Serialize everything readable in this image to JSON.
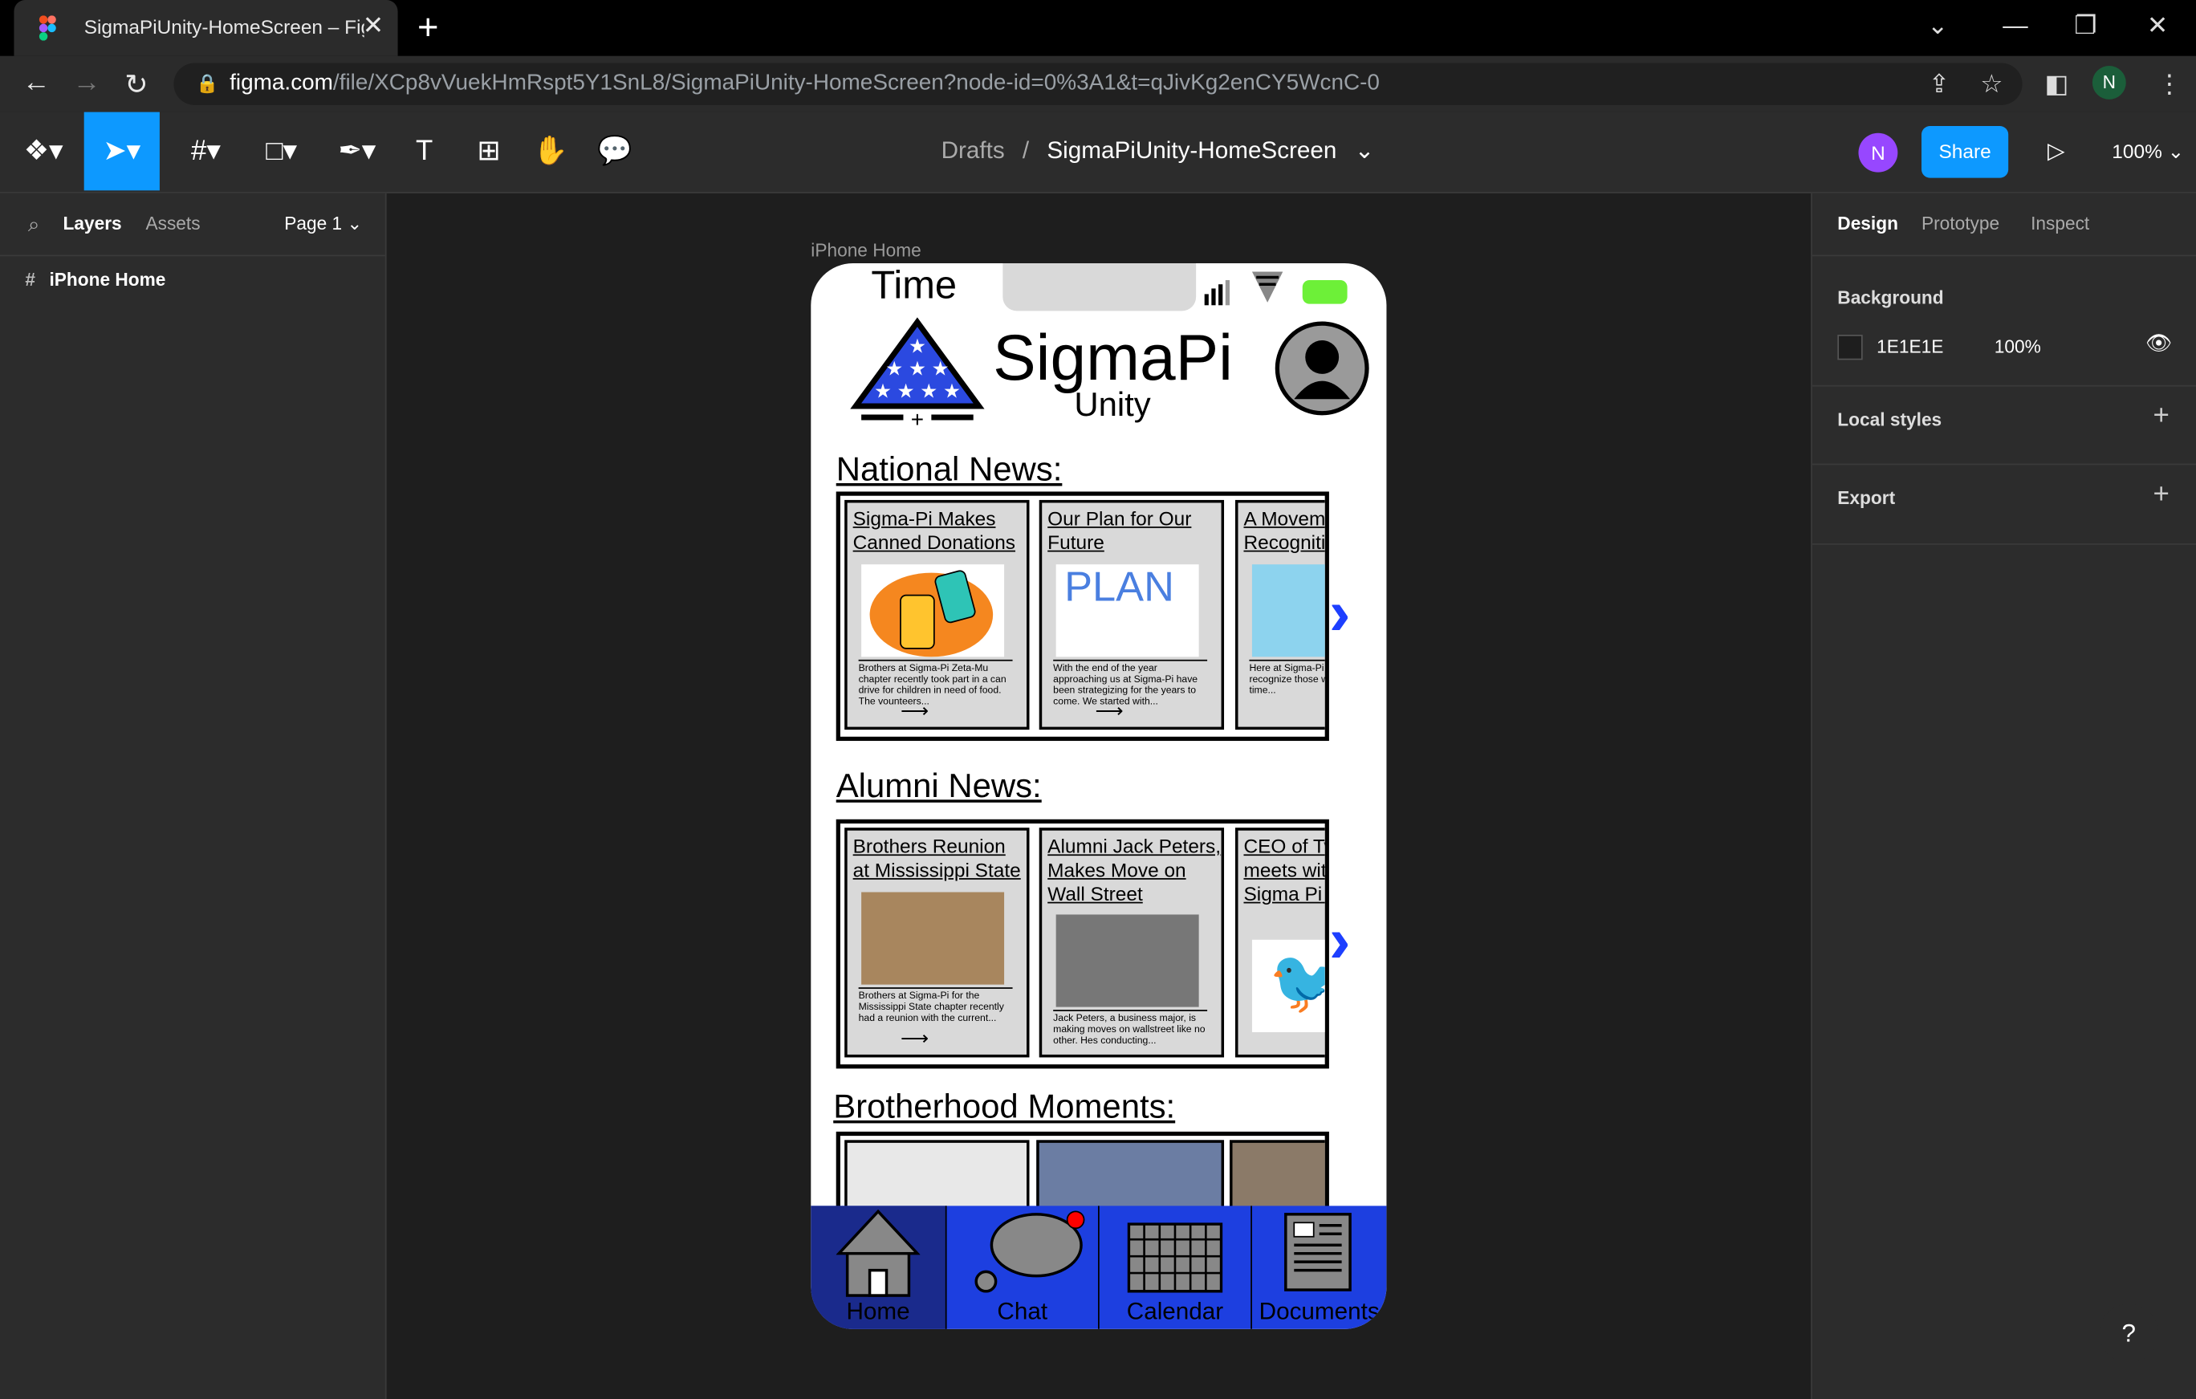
{
  "browser": {
    "tab_title": "SigmaPiUnity-HomeScreen – Figma",
    "new_tab": "+",
    "url_host": "figma.com",
    "url_path": "/file/XCp8vVuekHmRspt5Y1SnL8/SigmaPiUnity-HomeScreen?node-id=0%3A1&t=qJivKg2enCY5WcnC-0",
    "profile_initial": "N"
  },
  "toolbar": {
    "breadcrumb_parent": "Drafts",
    "breadcrumb_sep": "/",
    "file_name": "SigmaPiUnity-HomeScreen",
    "user_initial": "N",
    "share_label": "Share",
    "zoom": "100%"
  },
  "left_panel": {
    "tab_layers": "Layers",
    "tab_assets": "Assets",
    "page": "Page 1",
    "layer_item": "iPhone Home"
  },
  "right_panel": {
    "tab_design": "Design",
    "tab_prototype": "Prototype",
    "tab_inspect": "Inspect",
    "background_label": "Background",
    "bg_hex": "1E1E1E",
    "bg_opacity": "100%",
    "local_styles": "Local styles",
    "export": "Export"
  },
  "canvas": {
    "frame_label": "iPhone Home",
    "help": "?"
  },
  "phone": {
    "time": "Time",
    "app_title": "SigmaPi",
    "app_subtitle": "Unity",
    "national_title": "National News:",
    "national_cards": [
      {
        "title": "Sigma-Pi Makes Canned Donations",
        "desc": "Brothers at Sigma-Pi Zeta-Mu chapter recently took part in a can drive for children in need of food. The vounteers..."
      },
      {
        "title": "Our Plan for Our Future",
        "desc": "With the end of the year approaching us at Sigma-Pi have been strategizing for the years to come. We started with..."
      },
      {
        "title": "A Movement Recognition",
        "desc": "Here at Sigma-Pi to honor and recognize those who put their time..."
      }
    ],
    "plan_word": "PLAN",
    "alumni_title": "Alumni News:",
    "alumni_cards": [
      {
        "title": "Brothers Reunion at Mississippi State",
        "desc": "Brothers at Sigma-Pi for the Mississippi State chapter recently had a reunion with the current..."
      },
      {
        "title": "Alumni Jack Peters, Makes Move on Wall Street",
        "desc": "Jack Peters, a business major, is making moves on wallstreet like no other. Hes conducting..."
      },
      {
        "title": "CEO of Twitter meets with Former Sigma Pi Alumni",
        "desc": ""
      }
    ],
    "brotherhood_title": "Brotherhood Moments:",
    "nav": [
      {
        "label": "Home"
      },
      {
        "label": "Chat"
      },
      {
        "label": "Calendar"
      },
      {
        "label": "Documents"
      }
    ]
  }
}
